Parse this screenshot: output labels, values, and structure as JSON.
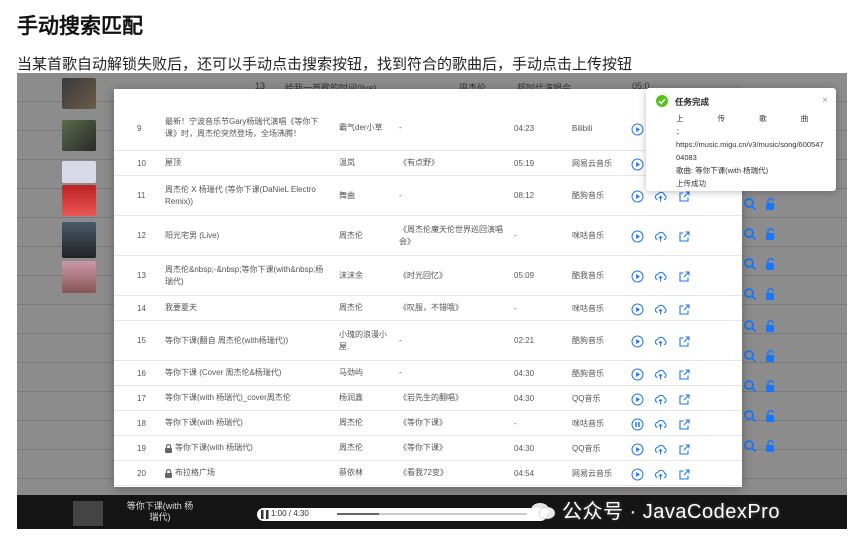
{
  "article": {
    "title": "手动搜索匹配",
    "description": "当某首歌自动解锁失败后，还可以手动点击搜索按钮，找到符合的歌曲后，手动点击上传按钮"
  },
  "background_row": {
    "index": "13",
    "title": "给我一首歌的时间(live)",
    "artist": "周杰伦",
    "album": "超时代演唱会",
    "duration": "05:0"
  },
  "results": [
    {
      "index": "9",
      "title": "最新！宁波音乐节Gary杨瑞代演唱《等你下课》时，周杰伦突然登场，全场沸腾！",
      "artist": "霸气der小草",
      "album": "-",
      "duration": "04:23",
      "source": "Bilibili",
      "locked": false,
      "play_state": "play"
    },
    {
      "index": "10",
      "title": "屋顶",
      "artist": "温岚",
      "album": "《有点野》",
      "duration": "05:19",
      "source": "网易云音乐",
      "locked": false,
      "play_state": "play"
    },
    {
      "index": "11",
      "title": "周杰伦 X 杨瑞代 (等你下课(DaNieL Electro Remix))",
      "artist": "舞曲",
      "album": "-",
      "duration": "08:12",
      "source": "酷狗音乐",
      "locked": false,
      "play_state": "play"
    },
    {
      "index": "12",
      "title": "阳光宅男 (Live)",
      "artist": "周杰伦",
      "album": "《周杰伦魔天伦世界巡回演唱会》",
      "duration": "-",
      "source": "咪咕音乐",
      "locked": false,
      "play_state": "play"
    },
    {
      "index": "13",
      "title": "周杰伦&nbsp;-&nbsp;等你下课(with&nbsp;杨瑞代)",
      "artist": "沫沫余",
      "album": "《时光回忆》",
      "duration": "05:09",
      "source": "酷我音乐",
      "locked": false,
      "play_state": "play"
    },
    {
      "index": "14",
      "title": "我要夏天",
      "artist": "周杰伦",
      "album": "《叹服，不错哦》",
      "duration": "-",
      "source": "咪咕音乐",
      "locked": false,
      "play_state": "play"
    },
    {
      "index": "15",
      "title": "等你下课(翻自 周杰伦(with杨瑞代))",
      "artist": "小瑰的浪漫小屋.",
      "album": "-",
      "duration": "02:21",
      "source": "酷狗音乐",
      "locked": false,
      "play_state": "play"
    },
    {
      "index": "16",
      "title": "等你下课 (Cover 周杰伦&杨瑞代)",
      "artist": "马劲屿",
      "album": "-",
      "duration": "04:30",
      "source": "酷狗音乐",
      "locked": false,
      "play_state": "play"
    },
    {
      "index": "17",
      "title": "等你下课(with 杨瑞代)_cover周杰伦",
      "artist": "杨润鑫",
      "album": "《岩先生的翻唱》",
      "duration": "04:30",
      "source": "QQ音乐",
      "locked": false,
      "play_state": "play"
    },
    {
      "index": "18",
      "title": "等你下课(with 杨瑞代)",
      "artist": "周杰伦",
      "album": "《等你下课》",
      "duration": "-",
      "source": "咪咕音乐",
      "locked": false,
      "play_state": "pause"
    },
    {
      "index": "19",
      "title": "等你下课(with 杨瑞代)",
      "artist": "周杰伦",
      "album": "《等你下课》",
      "duration": "04:30",
      "source": "QQ音乐",
      "locked": true,
      "play_state": "play"
    },
    {
      "index": "20",
      "title": "布拉格广场",
      "artist": "蔡依林",
      "album": "《看我72变》",
      "duration": "04:54",
      "source": "网易云音乐",
      "locked": true,
      "play_state": "play"
    }
  ],
  "toast": {
    "title": "任务完成",
    "heading": "上 传 歌 曲 ：",
    "url": "https://music.migu.cn/v3/music/song/60054704083",
    "song": "歌曲: 等你下课(with 杨瑞代)",
    "status": "上传成功",
    "close": "×"
  },
  "player": {
    "song_title": "等你下课(with 杨瑞代)",
    "time": "1:00 / 4:30",
    "progress": 0.22
  },
  "watermark": "公众号 · JavaCodexPro",
  "colors": {
    "accent": "#1677ff",
    "success": "#52c41a",
    "overlay": "#8c8c8c"
  }
}
